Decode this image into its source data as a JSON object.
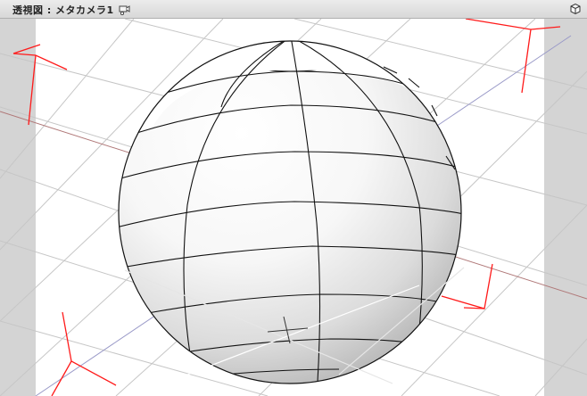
{
  "window": {
    "title": "透視図 : メタカメラ1"
  },
  "icons": {
    "camera": "camera-settings-icon",
    "view_cube": "view-cube-icon"
  },
  "colors": {
    "background": "#d4d4d4",
    "render_area": "#ffffff",
    "grid": "#c8c8c8",
    "axis_x": "#b07878",
    "axis_y": "#9090c0",
    "gizmo": "#ff1a1a",
    "wireframe": "#111111"
  }
}
